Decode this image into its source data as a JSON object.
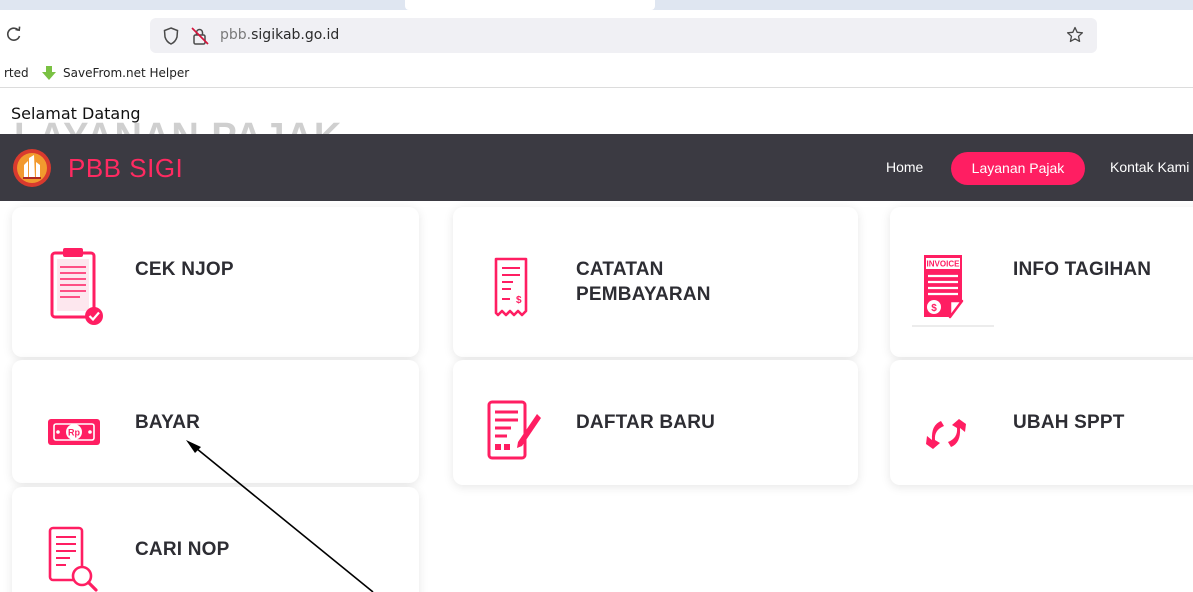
{
  "browser": {
    "url_domain": "pbb.",
    "url_rest": "sigikab.go.id",
    "bookmarks": [
      {
        "label": "rted"
      },
      {
        "label": "SaveFrom.net Helper"
      }
    ]
  },
  "page": {
    "welcome": "Selamat Datang",
    "ghost_heading": "LAYANAN PAJAK"
  },
  "nav": {
    "brand": "PBB SIGI",
    "home": "Home",
    "active": "Layanan Pajak",
    "contact": "Kontak Kami"
  },
  "cards": [
    {
      "title": "CEK NJOP",
      "icon": "clipboard-check-icon"
    },
    {
      "title_line1": "CATATAN",
      "title_line2": "PEMBAYARAN",
      "icon": "receipt-icon"
    },
    {
      "title": "INFO TAGIHAN",
      "icon": "invoice-icon",
      "icon_text": "INVOICE"
    },
    {
      "title": "BAYAR",
      "icon": "money-icon",
      "icon_text": "Rp"
    },
    {
      "title": "DAFTAR BARU",
      "icon": "document-edit-icon"
    },
    {
      "title": "UBAH SPPT",
      "icon": "refresh-arrows-icon"
    },
    {
      "title": "CARI NOP",
      "icon": "document-search-icon"
    }
  ],
  "colors": {
    "accent": "#ff1e62",
    "navbar": "#3b3a42",
    "card_title": "#2d2d33"
  }
}
